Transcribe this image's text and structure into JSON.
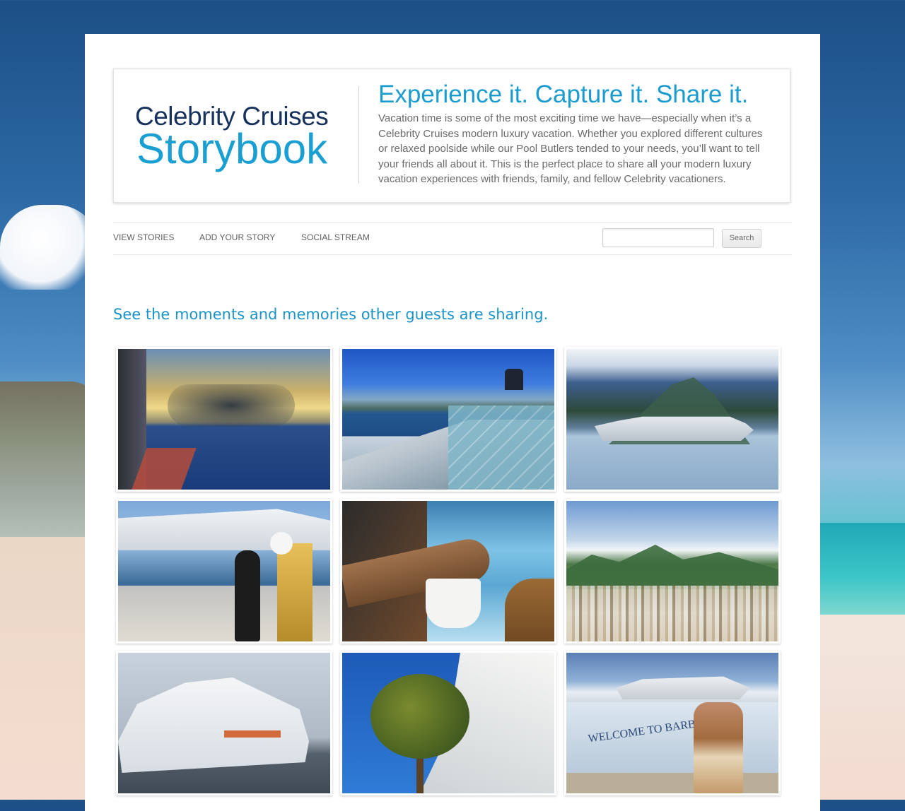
{
  "colors": {
    "accent": "#1b9ccf",
    "logo_dark": "#16325c",
    "nav_text": "#5f5f5f",
    "body_text": "#6a6a6a"
  },
  "header": {
    "logo_line1": "Celebrity Cruises",
    "logo_line2": "Storybook",
    "tagline": "Experience it. Capture it. Share it.",
    "intro": "Vacation time is some of the most exciting time we have—especially when it’s a Celebrity Cruises modern luxury vacation. Whether you explored different cultures or relaxed poolside while our Pool Butlers tended to your needs, you’ll want to tell your friends all about it. This is the perfect place to share all your modern luxury vacation experiences with friends, family, and fellow Celebrity vacationers."
  },
  "nav": {
    "items": [
      {
        "label": "VIEW STORIES"
      },
      {
        "label": "ADD YOUR STORY"
      },
      {
        "label": "SOCIAL STREAM"
      }
    ],
    "search": {
      "placeholder": "",
      "value": "",
      "button_label": "Search"
    }
  },
  "main": {
    "heading": "See the moments and memories other guests are sharing.",
    "photos": [
      {
        "name": "photo-sunset-sea",
        "icon": "photo-icon"
      },
      {
        "name": "photo-ship-deck-glacier",
        "icon": "photo-icon"
      },
      {
        "name": "photo-ship-mountains",
        "icon": "photo-icon"
      },
      {
        "name": "photo-guest-eclipse",
        "icon": "photo-icon"
      },
      {
        "name": "photo-coffee-balcony",
        "icon": "photo-icon"
      },
      {
        "name": "photo-island-town",
        "icon": "photo-icon"
      },
      {
        "name": "photo-reflection-docked",
        "icon": "photo-icon"
      },
      {
        "name": "photo-tree-ship-hull",
        "icon": "photo-icon"
      },
      {
        "name": "photo-welcome-barbados",
        "icon": "photo-icon",
        "sign_text": "WELCOME TO BARBADOS"
      }
    ]
  }
}
